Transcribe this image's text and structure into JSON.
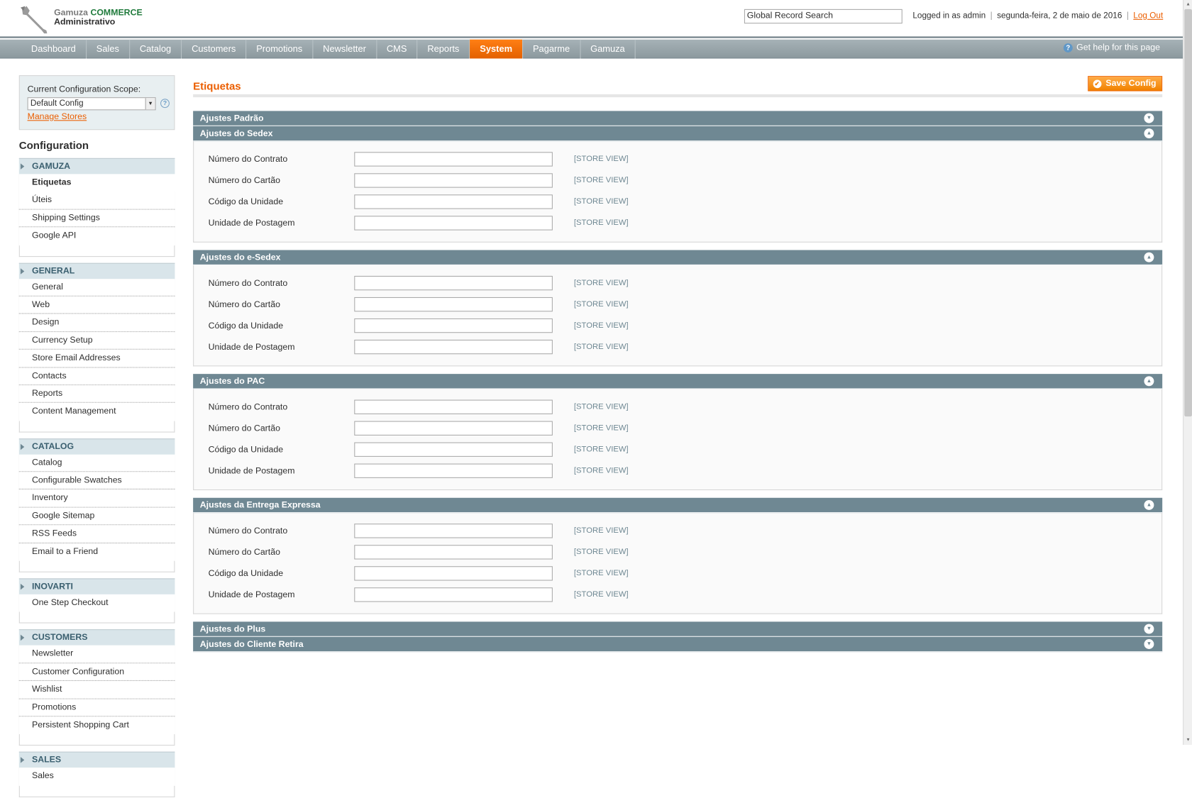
{
  "header": {
    "logo_line1_gray": "Gamuza",
    "logo_line1_green": "COMMERCE",
    "logo_line2": "Administrativo",
    "search_value": "Global Record Search",
    "logged_in": "Logged in as admin",
    "date": "segunda-feira, 2 de maio de 2016",
    "logout": "Log Out"
  },
  "nav": {
    "items": [
      "Dashboard",
      "Sales",
      "Catalog",
      "Customers",
      "Promotions",
      "Newsletter",
      "CMS",
      "Reports",
      "System",
      "Pagarme",
      "Gamuza"
    ],
    "active": "System",
    "help": "Get help for this page"
  },
  "scope": {
    "label": "Current Configuration Scope:",
    "selected": "Default Config",
    "manage": "Manage Stores"
  },
  "sidebar": {
    "title": "Configuration",
    "sections": [
      {
        "name": "GAMUZA",
        "items": [
          "Etiquetas",
          "Úteis",
          "Shipping Settings",
          "Google API"
        ]
      },
      {
        "name": "GENERAL",
        "items": [
          "General",
          "Web",
          "Design",
          "Currency Setup",
          "Store Email Addresses",
          "Contacts",
          "Reports",
          "Content Management"
        ]
      },
      {
        "name": "CATALOG",
        "items": [
          "Catalog",
          "Configurable Swatches",
          "Inventory",
          "Google Sitemap",
          "RSS Feeds",
          "Email to a Friend"
        ]
      },
      {
        "name": "INOVARTI",
        "items": [
          "One Step Checkout"
        ]
      },
      {
        "name": "CUSTOMERS",
        "items": [
          "Newsletter",
          "Customer Configuration",
          "Wishlist",
          "Promotions",
          "Persistent Shopping Cart"
        ]
      },
      {
        "name": "SALES",
        "items": [
          "Sales"
        ]
      }
    ],
    "active_item": "Etiquetas"
  },
  "main": {
    "title": "Etiquetas",
    "save_label": "Save Config",
    "scope_tag": "[STORE VIEW]",
    "fieldsets": [
      {
        "title": "Ajustes Padrão",
        "open": false,
        "fields": []
      },
      {
        "title": "Ajustes do Sedex",
        "open": true,
        "fields": [
          "Número do Contrato",
          "Número do Cartão",
          "Código da Unidade",
          "Unidade de Postagem"
        ]
      },
      {
        "title": "Ajustes do e-Sedex",
        "open": true,
        "fields": [
          "Número do Contrato",
          "Número do Cartão",
          "Código da Unidade",
          "Unidade de Postagem"
        ]
      },
      {
        "title": "Ajustes do PAC",
        "open": true,
        "fields": [
          "Número do Contrato",
          "Número do Cartão",
          "Código da Unidade",
          "Unidade de Postagem"
        ]
      },
      {
        "title": "Ajustes da Entrega Expressa",
        "open": true,
        "fields": [
          "Número do Contrato",
          "Número do Cartão",
          "Código da Unidade",
          "Unidade de Postagem"
        ]
      },
      {
        "title": "Ajustes do Plus",
        "open": false,
        "fields": []
      },
      {
        "title": "Ajustes do Cliente Retira",
        "open": false,
        "fields": []
      }
    ]
  }
}
